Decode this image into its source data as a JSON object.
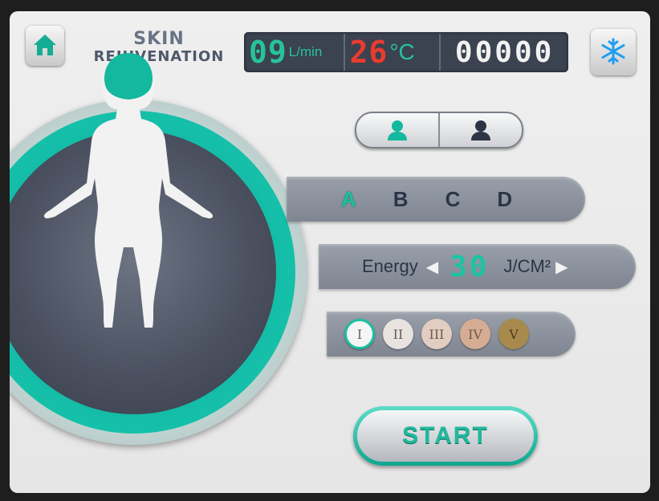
{
  "header": {
    "title_line1": "SKIN",
    "title_line2": "REJUVENATION"
  },
  "display": {
    "flow_value": "09",
    "flow_unit": "L/min",
    "temp_value": "26",
    "temp_unit": "°C",
    "counter": "00000"
  },
  "zones": {
    "items": [
      "A",
      "B",
      "C",
      "D"
    ],
    "selected": "A"
  },
  "energy": {
    "label": "Energy",
    "value": "30",
    "unit": "J/CM²"
  },
  "skin_types": {
    "items": [
      "I",
      "II",
      "III",
      "IV",
      "V"
    ],
    "selected": "I"
  },
  "start": {
    "label": "START"
  },
  "colors": {
    "accent": "#1bbf9e",
    "temp": "#ea3b2f",
    "bar": "#8a909b"
  },
  "icons": {
    "home": "home-icon",
    "snow": "snowflake-icon",
    "female": "female-user-icon",
    "male": "male-user-icon"
  }
}
